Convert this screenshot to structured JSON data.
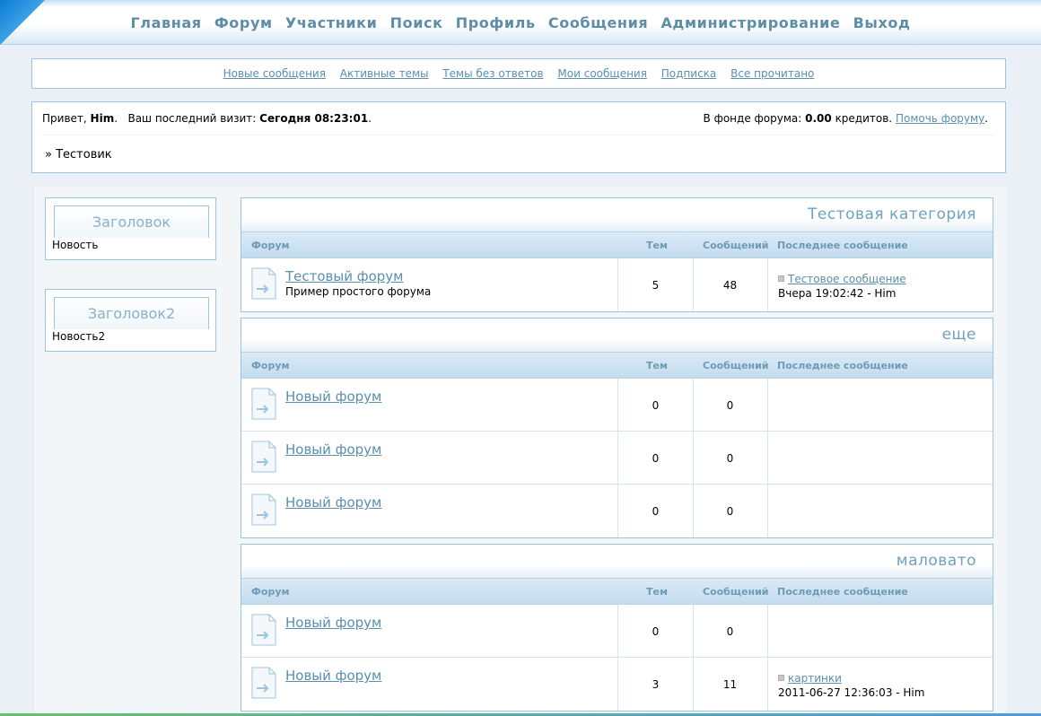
{
  "nav": {
    "items": [
      "Главная",
      "Форум",
      "Участники",
      "Поиск",
      "Профиль",
      "Сообщения",
      "Администрирование",
      "Выход"
    ]
  },
  "quicklinks": [
    "Новые сообщения",
    "Активные темы",
    "Темы без ответов",
    "Мои сообщения",
    "Подписка",
    "Все прочитано"
  ],
  "welcome": {
    "greeting": "Привет,",
    "user": "Him",
    "visit_label": "Ваш последний визит:",
    "visit_value": "Сегодня 08:23:01",
    "fund_label": "В фонде форума:",
    "fund_value": "0.00",
    "fund_unit": "кредитов.",
    "help_link": "Помочь форуму",
    "breadcrumb": "» Тестовик"
  },
  "sidebar": [
    {
      "title": "Заголовок",
      "body": "Новость"
    },
    {
      "title": "Заголовок2",
      "body": "Новость2"
    }
  ],
  "columns": {
    "forum": "Форум",
    "topics": "Тем",
    "posts": "Сообщений",
    "last": "Последнее сообщение"
  },
  "categories": [
    {
      "title": "Тестовая категория",
      "rows": [
        {
          "name": "Тестовый форум",
          "desc": "Пример простого форума",
          "topics": "5",
          "posts": "48",
          "last_link": "Тестовое сообщение",
          "last_info": "Вчера 19:02:42 - Him"
        }
      ]
    },
    {
      "title": "еще",
      "rows": [
        {
          "name": "Новый форум",
          "desc": "",
          "topics": "0",
          "posts": "0",
          "last_link": "",
          "last_info": ""
        },
        {
          "name": "Новый форум",
          "desc": "",
          "topics": "0",
          "posts": "0",
          "last_link": "",
          "last_info": ""
        },
        {
          "name": "Новый форум",
          "desc": "",
          "topics": "0",
          "posts": "0",
          "last_link": "",
          "last_info": ""
        }
      ]
    },
    {
      "title": "маловато",
      "rows": [
        {
          "name": "Новый форум",
          "desc": "",
          "topics": "0",
          "posts": "0",
          "last_link": "",
          "last_info": ""
        },
        {
          "name": "Новый форум",
          "desc": "",
          "topics": "3",
          "posts": "11",
          "last_link": "картинки",
          "last_info": "2011-06-27 12:36:03 - Him"
        }
      ]
    }
  ]
}
